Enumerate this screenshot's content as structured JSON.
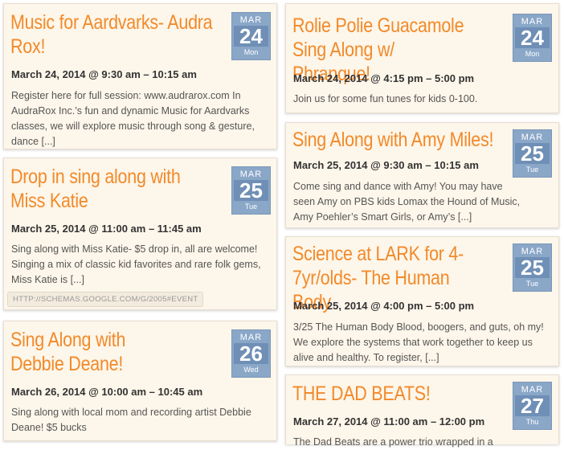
{
  "events": [
    {
      "title": "Music for Aardvarks- Audra Rox!",
      "month": "MAR",
      "day": "24",
      "weekday": "Mon",
      "date": "March 24, 2014 @ 9:30 am – 10:15 am",
      "description": "Register here for full session: www.audrarox.com In AudraRox Inc.’s fun and dynamic Music for Aardvarks classes, we will explore music through song & gesture, dance [...]"
    },
    {
      "title": "Drop in sing along with Miss Katie",
      "month": "MAR",
      "day": "25",
      "weekday": "Tue",
      "date": "March 25, 2014 @ 11:00 am – 11:45 am",
      "description": "Sing along with Miss Katie- $5 drop in, all are welcome! Singing a mix of classic kid favorites and rare folk gems, Miss Katie is [...]",
      "tag": "HTTP://SCHEMAS.GOOGLE.COM/G/2005#EVENT"
    },
    {
      "title": "Sing Along with Debbie Deane!",
      "month": "MAR",
      "day": "26",
      "weekday": "Wed",
      "date": "March 26, 2014 @ 10:00 am – 10:45 am",
      "description": "Sing along with local mom and recording artist Debbie Deane! $5 bucks"
    },
    {
      "title": "Rolie Polie Guacamole Sing Along w/ Phranque!",
      "month": "MAR",
      "day": "24",
      "weekday": "Mon",
      "date": "March 24, 2014 @ 4:15 pm – 5:00 pm",
      "description": "Join us for some fun tunes for kids 0-100."
    },
    {
      "title": "Sing Along with Amy Miles!",
      "month": "MAR",
      "day": "25",
      "weekday": "Tue",
      "date": "March 25, 2014 @ 9:30 am – 10:15 am",
      "description": "Come sing and dance with Amy! You may have seen Amy on PBS kids Lomax the Hound of Music, Amy Poehler’s Smart Girls, or Amy’s [...]"
    },
    {
      "title": "Science at LARK for 4-7yr/olds- The Human Body",
      "month": "MAR",
      "day": "25",
      "weekday": "Tue",
      "date": "March 25, 2014 @ 4:00 pm – 5:00 pm",
      "description": "3/25 The Human Body Blood, boogers, and guts, oh my! We explore the systems that work together to keep us alive and healthy. To register, [...]"
    },
    {
      "title": "THE DAD BEATS!",
      "month": "MAR",
      "day": "27",
      "weekday": "Thu",
      "date": "March 27, 2014 @ 11:00 am – 12:00 pm",
      "description": "The Dad Beats are a power trio wrapped in a"
    }
  ],
  "colors": {
    "title": "#f28a2a",
    "badge": "#8aa7c8",
    "card": "#fdf6ea"
  }
}
